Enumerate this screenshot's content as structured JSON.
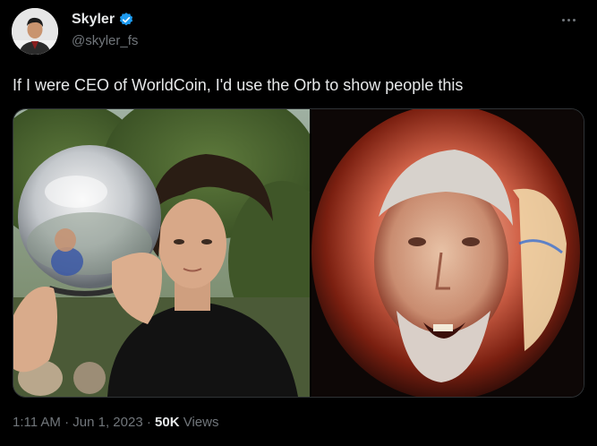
{
  "author": {
    "display_name": "Skyler",
    "handle": "@skyler_fs",
    "verified": true
  },
  "tweet": {
    "text": "If I were CEO of WorldCoin, I'd use the Orb to show people this",
    "time": "1:11 AM",
    "separator": "·",
    "date": "Jun 1, 2023",
    "views_count": "50K",
    "views_label": "Views"
  },
  "icons": {
    "more": "more-horizontal-icon",
    "verified": "verified-badge-icon"
  },
  "colors": {
    "background": "#000000",
    "text_primary": "#e7e9ea",
    "text_secondary": "#71767b",
    "verified_blue": "#1d9bf0",
    "border": "#2f3336"
  }
}
